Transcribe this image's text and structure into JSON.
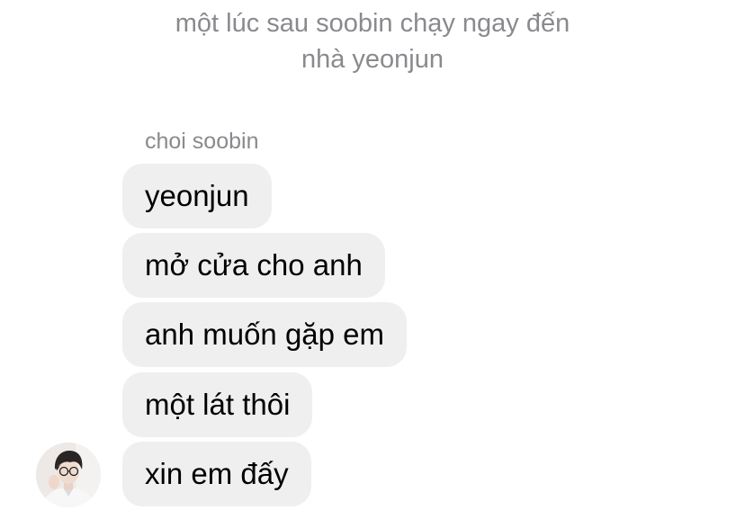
{
  "narration": {
    "line1": "một lúc sau soobin chạy ngay đến",
    "line2": "nhà yeonjun"
  },
  "sender": {
    "name": "choi soobin"
  },
  "messages": [
    {
      "text": "yeonjun"
    },
    {
      "text": "mở cửa cho anh"
    },
    {
      "text": "anh muốn gặp em"
    },
    {
      "text": "một lát thôi"
    },
    {
      "text": "xin em đấy"
    }
  ],
  "colors": {
    "bubble": "#efefef",
    "meta_text": "#8a8a8e",
    "message_text": "#000000"
  }
}
